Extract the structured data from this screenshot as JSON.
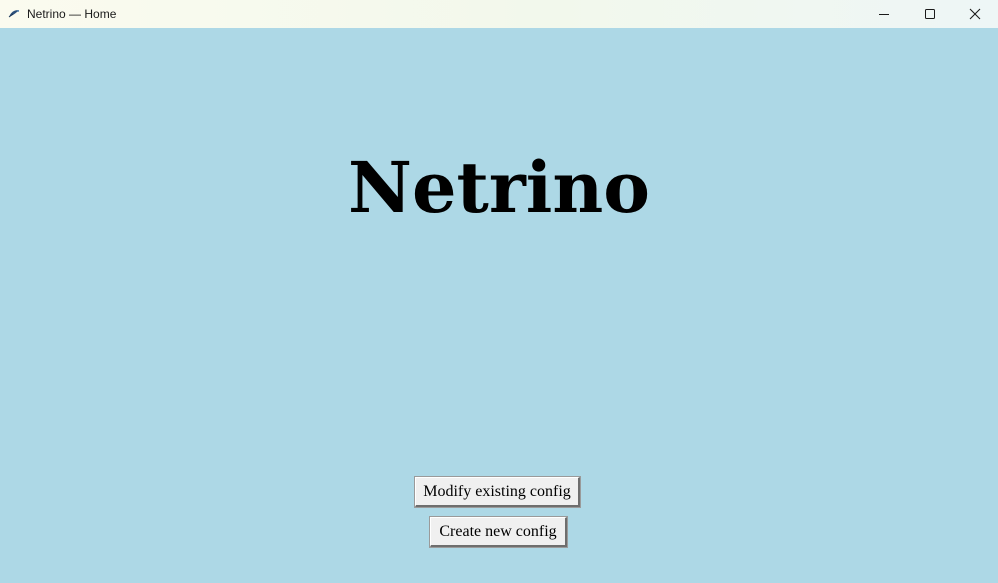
{
  "window": {
    "title": "Netrino — Home",
    "background_color": "#add8e6"
  },
  "titlebar": {
    "app_icon": "feather-icon",
    "controls": {
      "minimize_icon": "minimize-icon",
      "maximize_icon": "maximize-icon",
      "close_icon": "close-icon"
    }
  },
  "main": {
    "heading": "Netrino",
    "buttons": {
      "modify_label": "Modify existing config",
      "create_label": "Create new config"
    }
  }
}
